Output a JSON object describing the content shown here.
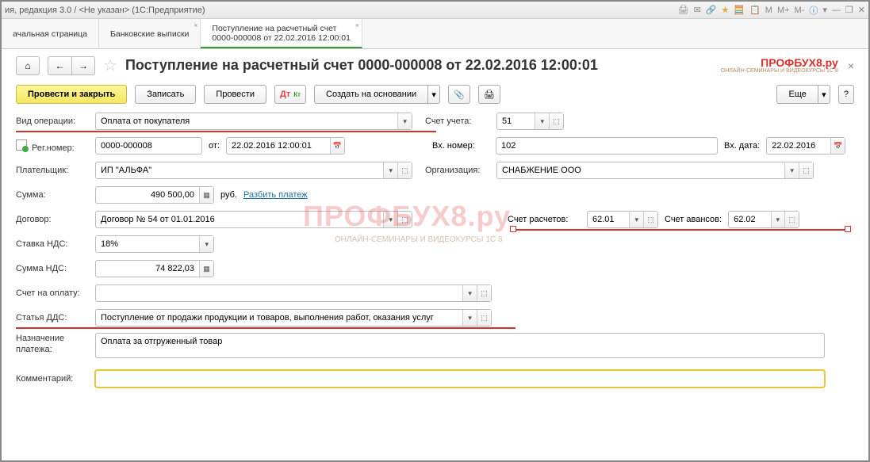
{
  "titlebar": {
    "text": "ия, редакция 3.0 / <Не указан>  (1С:Предприятие)",
    "icons_mtext": [
      "M",
      "M+",
      "M-"
    ]
  },
  "tabs": [
    {
      "label": "ачальная страница"
    },
    {
      "label": "Банковские выписки"
    },
    {
      "label1": "Поступление на расчетный счет",
      "label2": "0000-000008 от 22.02.2016 12:00:01"
    }
  ],
  "page": {
    "title": "Поступление на расчетный счет 0000-000008 от 22.02.2016 12:00:01",
    "logo": "ПРОФБУХ8.ру",
    "logo_sub": "ОНЛАЙН-СЕМИНАРЫ И ВИДЕОКУРСЫ 1С 8"
  },
  "cmdbar": {
    "post_close": "Провести и закрыть",
    "save": "Записать",
    "post": "Провести",
    "create_based": "Создать на основании",
    "more": "Еще",
    "help": "?"
  },
  "fields": {
    "operation_type_label": "Вид операции:",
    "operation_type": "Оплата от покупателя",
    "account_label": "Счет учета:",
    "account": "51",
    "regnum_label": "Рег.номер:",
    "regnum": "0000-000008",
    "date_label": "от:",
    "date": "22.02.2016 12:00:01",
    "incnum_label": "Вх. номер:",
    "incnum": "102",
    "incdate_label": "Вх. дата:",
    "incdate": "22.02.2016",
    "payer_label": "Плательщик:",
    "payer": "ИП \"АЛЬФА\"",
    "org_label": "Организация:",
    "org": "СНАБЖЕНИЕ ООО",
    "sum_label": "Сумма:",
    "sum": "490 500,00",
    "currency": "руб.",
    "split_link": "Разбить платеж",
    "contract_label": "Договор:",
    "contract": "Договор № 54 от 01.01.2016",
    "acct_calc_label": "Счет расчетов:",
    "acct_calc": "62.01",
    "acct_adv_label": "Счет авансов:",
    "acct_adv": "62.02",
    "vat_rate_label": "Ставка НДС:",
    "vat_rate": "18%",
    "vat_sum_label": "Сумма НДС:",
    "vat_sum": "74 822,03",
    "invoice_label": "Счет на оплату:",
    "invoice": "",
    "dds_label": "Статья ДДС:",
    "dds": "Поступление от продажи продукции и товаров, выполнения работ, оказания услуг",
    "purpose_label": "Назначение платежа:",
    "purpose": "Оплата за отгруженный товар",
    "comment_label": "Комментарий:",
    "comment": ""
  },
  "watermark": "ПРОФБУХ8.ру",
  "watermark_sub": "ОНЛАЙН-СЕМИНАРЫ И ВИДЕОКУРСЫ 1С 8"
}
